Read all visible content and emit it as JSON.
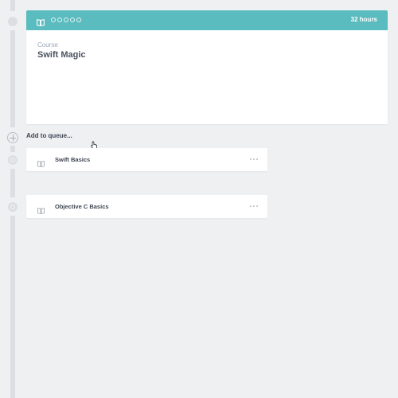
{
  "course": {
    "kicker": "Course",
    "title": "Swift Magic",
    "duration": "32 hours",
    "rating_total": 5,
    "rating_filled": 0
  },
  "queue": {
    "add_label": "Add to queue...",
    "items": [
      {
        "label": "Swift Basics"
      },
      {
        "label": "Objective C Basics"
      }
    ]
  },
  "icons": {
    "book": "book-icon",
    "more": "more-icon",
    "add": "plus-circle-icon",
    "cursor": "hand-pointer-icon"
  },
  "colors": {
    "accent": "#5bbcbf",
    "background": "#eff0f2",
    "card": "#ffffff",
    "rail": "#dcdee2"
  }
}
